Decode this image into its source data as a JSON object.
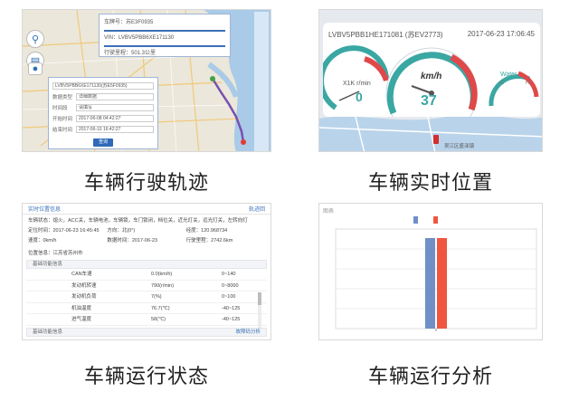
{
  "panels": {
    "trajectory": {
      "caption": "车辆行驶轨迹",
      "info": {
        "plate": "车牌号：苏E3F0935",
        "vin": "VIN：LVBV5PBB6XE171130",
        "mileage": "行驶里程：501.3公里"
      },
      "form": {
        "vehicle_value": "LVBV5PBB6XE171130(苏E5F0935)",
        "rows": [
          {
            "label": "数据类型",
            "value": "详细数据"
          },
          {
            "label": "时间段",
            "value": "请填写"
          },
          {
            "label": "开始时间",
            "value": "2017-06-08 04:42:27"
          },
          {
            "label": "结束时间",
            "value": "2017-06-10 16:42:27"
          }
        ],
        "query_label": "查询"
      },
      "tools": [
        "search-icon",
        "layers-icon",
        "location-icon"
      ]
    },
    "realtime": {
      "caption": "车辆实时位置",
      "vin_plate": "LVBV5PBB1HE171081 (苏EV2773)",
      "datetime": "2017-06-23 17:06:45",
      "rpm_unit": "X1K r/min",
      "rpm_value": "0",
      "speed_unit": "km/h",
      "speed_value": "37",
      "water_label": "Water",
      "water_low": "C",
      "water_high": "H",
      "map_label": "吴江区盛泽镇"
    },
    "status": {
      "caption": "车辆运行状态",
      "header": "实时位置信息",
      "header_link": "轨迹回",
      "line1": "车辆状态：熄火，ACC关，车辆电池，车辆锁，车门锁闭，档位关，近光灯关，远光灯关，左转向灯",
      "grid": [
        "定位时间：2017-06-23 16:45:45",
        "方向：北(0°)",
        "经度：120.968734",
        "速度：0km/h",
        "数据时间：2017-06-23",
        "行驶里程：2742.6km"
      ],
      "line2": "位置信息：江苏省苏州市",
      "sub_header": "基础功能信息",
      "rows": [
        {
          "name": "CAN车速",
          "value": "0.0(km/h)",
          "range": "0~140"
        },
        {
          "name": "发动机转速",
          "value": "790(r/min)",
          "range": "0~8000"
        },
        {
          "name": "发动机负荷",
          "value": "7(%)",
          "range": "0~100"
        },
        {
          "name": "机油温度",
          "value": "76.7(℃)",
          "range": "-40~125"
        },
        {
          "name": "进气温度",
          "value": "58(℃)",
          "range": "-40~125"
        }
      ],
      "footer": "基础功能信息",
      "footer_link": "故障码分析"
    },
    "analysis": {
      "caption": "车辆运行分析",
      "tab": "图表"
    }
  },
  "chart_data": {
    "type": "bar",
    "categories": [
      ""
    ],
    "series": [
      {
        "name": "",
        "values": [
          100
        ],
        "color": "#6f8fc6"
      },
      {
        "name": "",
        "values": [
          100
        ],
        "color": "#f0563f"
      }
    ],
    "ylim": [
      0,
      110
    ],
    "grid": true,
    "legend": "top"
  },
  "colors": {
    "accent_blue": "#2e6ab8",
    "gauge_red": "#e0484a",
    "gauge_teal": "#3aa7a3"
  }
}
